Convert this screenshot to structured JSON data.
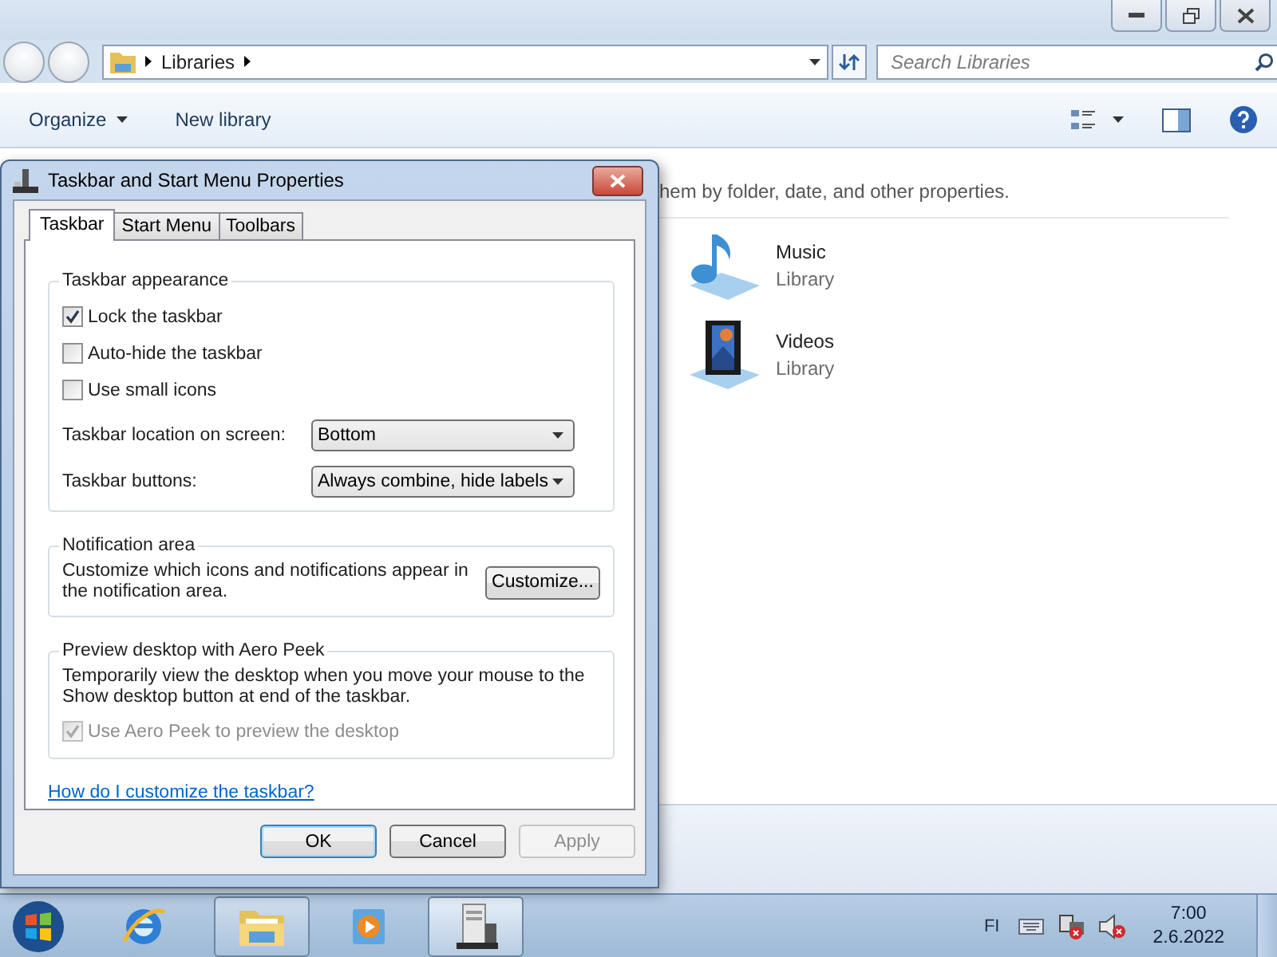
{
  "explorer": {
    "address": {
      "path": "Libraries"
    },
    "search": {
      "placeholder": "Search Libraries"
    },
    "commands": [
      {
        "label": "Organize",
        "has_menu": true
      },
      {
        "label": "New library",
        "has_menu": false
      }
    ],
    "content": {
      "description": "hem by folder, date, and other properties.",
      "libraries": [
        {
          "name": "Music",
          "type": "Library",
          "kind": "music"
        },
        {
          "name": "Videos",
          "type": "Library",
          "kind": "videos"
        }
      ]
    }
  },
  "dialog": {
    "title": "Taskbar and Start Menu Properties",
    "tabs": [
      {
        "label": "Taskbar",
        "selected": true
      },
      {
        "label": "Start Menu",
        "selected": false
      },
      {
        "label": "Toolbars",
        "selected": false
      }
    ],
    "appearance": {
      "title": "Taskbar appearance",
      "checkboxes": [
        {
          "label": "Lock the taskbar",
          "checked": true
        },
        {
          "label": "Auto-hide the taskbar",
          "checked": false
        },
        {
          "label": "Use small icons",
          "checked": false
        }
      ],
      "dropdowns": [
        {
          "label": "Taskbar location on screen:",
          "value": "Bottom"
        },
        {
          "label": "Taskbar buttons:",
          "value": "Always combine, hide labels"
        }
      ]
    },
    "notification": {
      "title": "Notification area",
      "text": "Customize which icons and notifications appear in the notification area.",
      "button": "Customize..."
    },
    "peek": {
      "title": "Preview desktop with Aero Peek",
      "text": "Temporarily view the desktop when you move your mouse to the Show desktop button at end of the taskbar.",
      "checkbox": {
        "label": "Use Aero Peek to preview the desktop",
        "checked": true,
        "disabled": true
      }
    },
    "link": "How do I customize the taskbar?",
    "buttons": [
      {
        "label": "OK",
        "disabled": false,
        "default": true
      },
      {
        "label": "Cancel",
        "disabled": false,
        "default": false
      },
      {
        "label": "Apply",
        "disabled": true,
        "default": false
      }
    ]
  },
  "taskbar": {
    "apps": [
      {
        "kind": "browser",
        "open": false,
        "selected": false
      },
      {
        "kind": "folder",
        "open": true,
        "selected": false
      },
      {
        "kind": "media",
        "open": false,
        "selected": false
      },
      {
        "kind": "properties",
        "open": true,
        "selected": true
      }
    ],
    "language": "FI",
    "time": "7:00",
    "date": "2.6.2022"
  }
}
